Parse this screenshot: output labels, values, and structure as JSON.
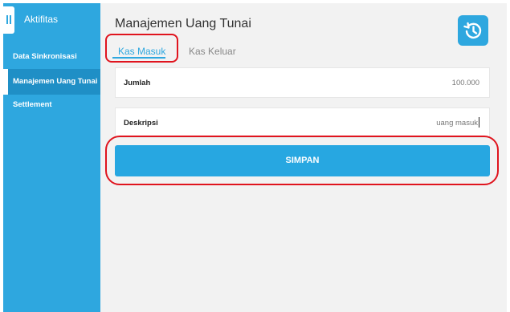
{
  "sidebar": {
    "title": "Aktifitas",
    "items": [
      {
        "label": "Data Sinkronisasi"
      },
      {
        "label": "Manajemen Uang Tunai"
      },
      {
        "label": "Settlement"
      }
    ]
  },
  "main": {
    "title": "Manajemen Uang Tunai",
    "tabs": [
      {
        "label": "Kas Masuk"
      },
      {
        "label": "Kas Keluar"
      }
    ],
    "fields": {
      "jumlah": {
        "label": "Jumlah",
        "value": "100.000"
      },
      "deskripsi": {
        "label": "Deskripsi",
        "value": "uang masuk"
      }
    },
    "save_label": "SIMPAN"
  },
  "icons": {
    "toggle": "menu-toggle-icon",
    "history": "history-icon"
  },
  "colors": {
    "accent": "#2ea7df",
    "annotation": "#e0141e"
  }
}
